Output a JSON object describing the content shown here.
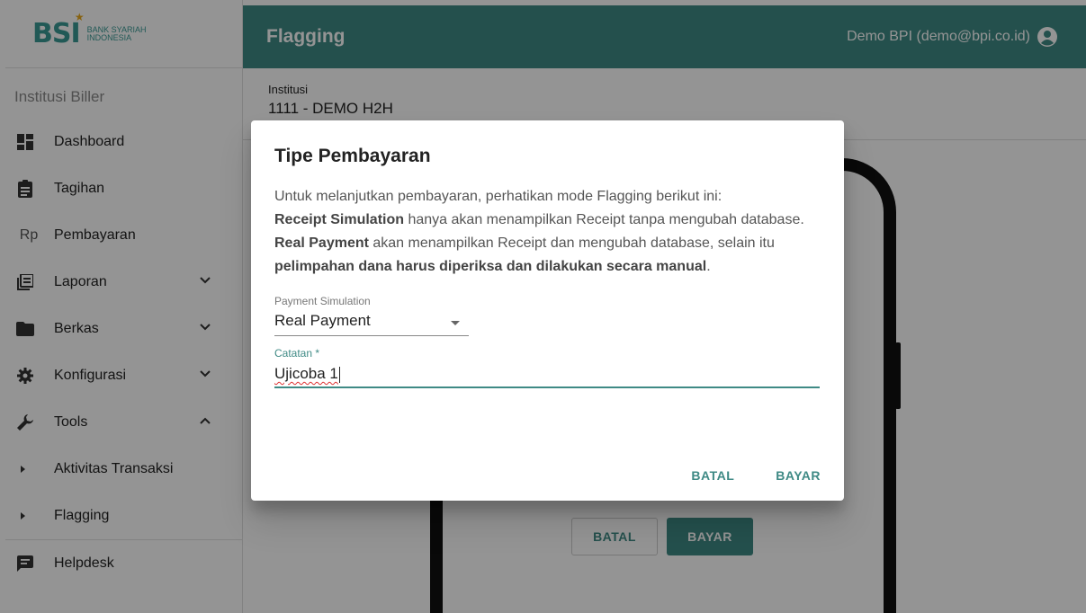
{
  "brand": {
    "logo": "BSI",
    "line1": "BANK SYARIAH",
    "line2": "INDONESIA"
  },
  "header": {
    "title": "Flagging",
    "user": "Demo BPI (demo@bpi.co.id)"
  },
  "sidebar": {
    "section": "Institusi Biller",
    "items": [
      {
        "label": "Dashboard",
        "icon": "dashboard-icon"
      },
      {
        "label": "Tagihan",
        "icon": "clipboard-icon"
      },
      {
        "label": "Pembayaran",
        "icon": "rp-icon",
        "glyph": "Rp"
      },
      {
        "label": "Laporan",
        "icon": "report-icon"
      },
      {
        "label": "Berkas",
        "icon": "folder-icon"
      },
      {
        "label": "Konfigurasi",
        "icon": "gear-icon"
      },
      {
        "label": "Tools",
        "icon": "wrench-icon"
      },
      {
        "label": "Aktivitas Transaksi"
      },
      {
        "label": "Flagging"
      },
      {
        "label": "Helpdesk",
        "icon": "chat-icon"
      }
    ]
  },
  "content": {
    "institution_label": "Institusi",
    "institution_value": "1111 - DEMO H2H",
    "btn_batal": "BATAL",
    "btn_bayar": "BAYAR"
  },
  "dialog": {
    "title": "Tipe Pembayaran",
    "intro": "Untuk melanjutkan pembayaran, perhatikan mode Flagging berikut ini:",
    "receipt_bold": "Receipt Simulation",
    "receipt_text": " hanya akan menampilkan Receipt tanpa mengubah database.",
    "real_bold": "Real Payment",
    "real_text": " akan menampilkan Receipt dan mengubah database, selain itu ",
    "real_bold2": "pelimpahan dana harus diperiksa dan dilakukan secara manual",
    "real_end": ".",
    "select_label": "Payment Simulation",
    "select_value": "Real Payment",
    "catatan_label": "Catatan *",
    "catatan_value": "Ujicoba 1",
    "cancel": "BATAL",
    "confirm": "BAYAR"
  },
  "colors": {
    "primary": "#3f8a85",
    "accent": "#e8a91d"
  }
}
